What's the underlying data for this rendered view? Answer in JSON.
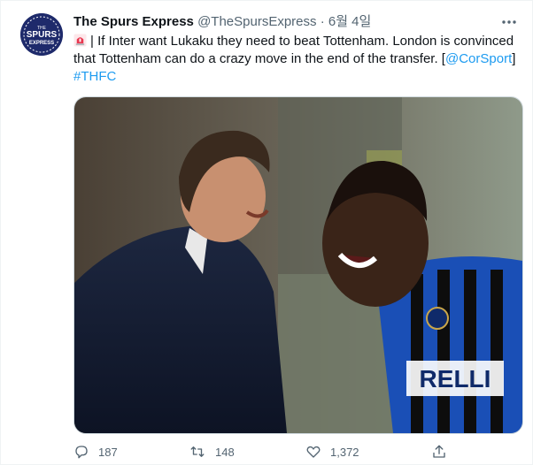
{
  "tweet": {
    "author_name": "The Spurs Express",
    "author_handle": "@TheSpursExpress",
    "separator": "·",
    "date": "6월 4일",
    "avatar_text_line1": "THE",
    "avatar_text_line2": "SPURS",
    "avatar_text_line3": "EXPRESS",
    "text_part1": "| If Inter want Lukaku they need to beat Tottenham. London is convinced that Tottenham can do a crazy move in the end of the transfer. [",
    "mention": "@CorSport",
    "text_part2": "]",
    "hashtag": "#THFC",
    "media_jersey_text": "RELLI",
    "reply_count": "187",
    "retweet_count": "148",
    "like_count": "1,372"
  },
  "colors": {
    "link": "#1d9bf0",
    "secondary_text": "#536471",
    "avatar_bg": "#1e2a6b"
  },
  "icons": {
    "siren": "siren-emoji-icon",
    "more": "more-horizontal-icon",
    "reply": "reply-icon",
    "retweet": "retweet-icon",
    "like": "heart-icon",
    "share": "share-icon"
  }
}
